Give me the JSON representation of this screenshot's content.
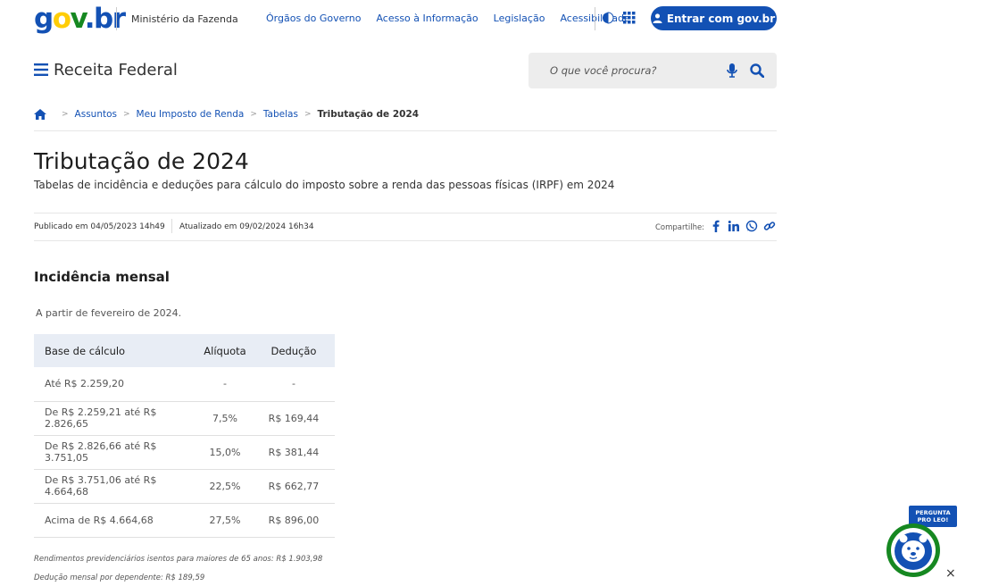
{
  "header": {
    "logo": {
      "g": "g",
      "o": "o",
      "v": "v",
      "dot": ".",
      "b": "b",
      "r": "r"
    },
    "ministry": "Ministério da Fazenda",
    "links": [
      "Órgãos do Governo",
      "Acesso à Informação",
      "Legislação",
      "Acessibilidade"
    ],
    "login_label": "Entrar com gov.br"
  },
  "subheader": {
    "site_title": "Receita Federal",
    "search_placeholder": "O que você procura?"
  },
  "breadcrumb": {
    "items": [
      "Assuntos",
      "Meu Imposto de Renda",
      "Tabelas"
    ],
    "current": "Tributação de 2024"
  },
  "page": {
    "title": "Tributação de 2024",
    "description": "Tabelas de incidência e deduções para cálculo do imposto sobre a renda das pessoas físicas (IRPF) em 2024",
    "published": "Publicado em 04/05/2023 14h49",
    "updated": "Atualizado em 09/02/2024 16h34",
    "share_label": "Compartilhe:"
  },
  "section": {
    "title": "Incidência mensal",
    "note": "A partir de fevereiro de 2024."
  },
  "table": {
    "headers": [
      "Base de cálculo",
      "Alíquota",
      "Dedução"
    ],
    "rows": [
      [
        "Até R$ 2.259,20",
        "-",
        "-"
      ],
      [
        "De R$ 2.259,21 até R$ 2.826,65",
        "7,5%",
        "R$ 169,44"
      ],
      [
        "De R$ 2.826,66 até R$ 3.751,05",
        "15,0%",
        "R$ 381,44"
      ],
      [
        "De R$ 3.751,06 até R$ 4.664,68",
        "22,5%",
        "R$ 662,77"
      ],
      [
        "Acima de R$ 4.664,68",
        "27,5%",
        "R$ 896,00"
      ]
    ]
  },
  "footnotes": [
    "Rendimentos previdenciários isentos para maiores de 65 anos: R$ 1.903,98",
    "Dedução mensal por dependente: R$ 189,59"
  ],
  "chatbot": {
    "badge_line1": "PERGUNTA",
    "badge_line2": "PRO LEO!",
    "close": "×"
  },
  "colors": {
    "primary": "#1351b4",
    "green": "#168821",
    "yellow": "#ffcd07"
  }
}
